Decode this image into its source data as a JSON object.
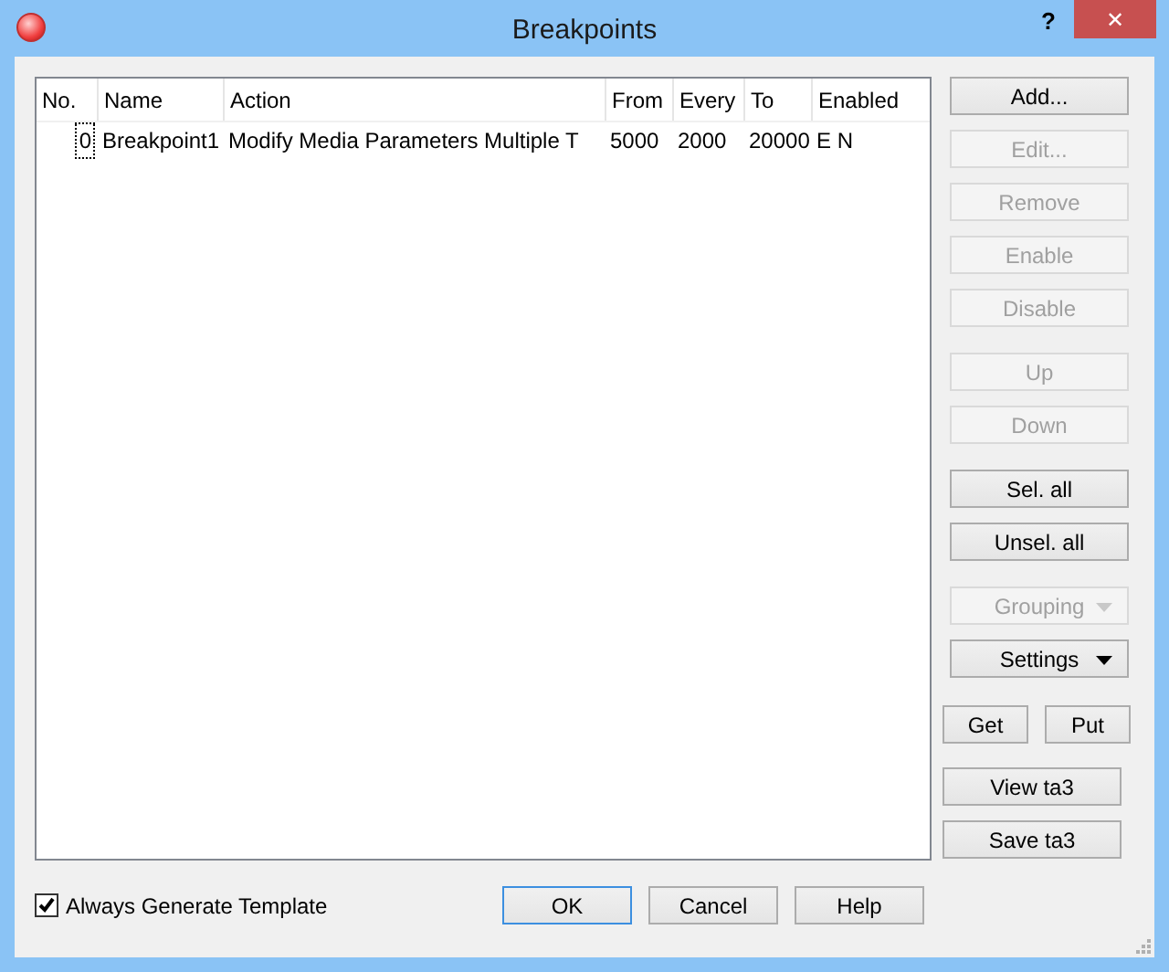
{
  "window": {
    "title": "Breakpoints",
    "help": "?",
    "close": "✕"
  },
  "table": {
    "columns": [
      "No.",
      "Name",
      "Action",
      "From",
      "Every",
      "To",
      "Enabled"
    ],
    "rows": [
      {
        "cells": [
          "0",
          "Breakpoint1",
          "Modify Media Parameters Multiple T",
          "5000",
          "2000",
          "20000",
          "E N"
        ],
        "focused": true
      }
    ]
  },
  "button_groups": [
    [
      {
        "label": "Add...",
        "disabled": false,
        "kind": "button"
      },
      {
        "label": "Edit...",
        "disabled": true,
        "kind": "button"
      },
      {
        "label": "Remove",
        "disabled": true,
        "kind": "button"
      },
      {
        "label": "Enable",
        "disabled": true,
        "kind": "button"
      },
      {
        "label": "Disable",
        "disabled": true,
        "kind": "button"
      }
    ],
    [
      {
        "label": "Up",
        "disabled": true,
        "kind": "button"
      },
      {
        "label": "Down",
        "disabled": true,
        "kind": "button"
      }
    ],
    [
      {
        "label": "Sel. all",
        "disabled": false,
        "kind": "button"
      },
      {
        "label": "Unsel. all",
        "disabled": false,
        "kind": "button"
      }
    ],
    [
      {
        "label": "Grouping",
        "disabled": true,
        "kind": "dropdown"
      },
      {
        "label": "Settings",
        "disabled": false,
        "kind": "dropdown"
      }
    ]
  ],
  "get_put": [
    "Get",
    "Put"
  ],
  "ta3_buttons": [
    "View ta3",
    "Save ta3"
  ],
  "always_generate_template": {
    "label": "Always Generate Template",
    "checked": true
  },
  "dialog_buttons": [
    {
      "label": "OK",
      "default": true
    },
    {
      "label": "Cancel",
      "default": false
    },
    {
      "label": "Help",
      "default": false
    }
  ]
}
